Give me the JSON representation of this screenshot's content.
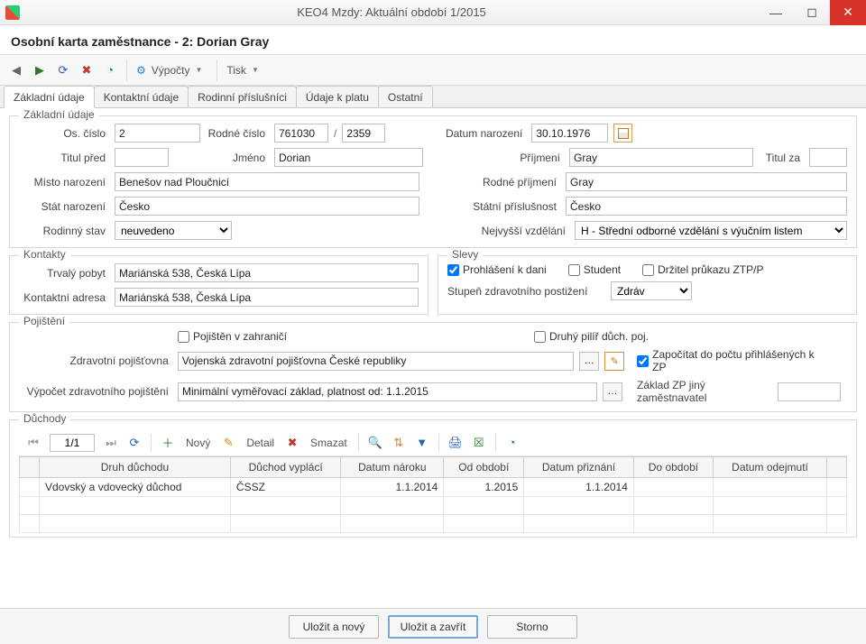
{
  "window": {
    "title": "KEO4 Mzdy: Aktuální období 1/2015"
  },
  "subtitle": "Osobní karta zaměstnance - 2: Dorian Gray",
  "toolbar": {
    "vypocty": "Výpočty",
    "tisk": "Tisk"
  },
  "tabs": [
    "Základní údaje",
    "Kontaktní údaje",
    "Rodinní příslušníci",
    "Údaje k platu",
    "Ostatní"
  ],
  "basic": {
    "legend": "Základní údaje",
    "lbl_oscislo": "Os. číslo",
    "oscislo": "2",
    "lbl_rodnecislo": "Rodné číslo",
    "rc1": "761030",
    "rc_sep": "/",
    "rc2": "2359",
    "lbl_datnar": "Datum narození",
    "datnar": "30.10.1976",
    "lbl_titulpred": "Titul před",
    "titulpred": "",
    "lbl_jmeno": "Jméno",
    "jmeno": "Dorian",
    "lbl_prijmeni": "Příjmení",
    "prijmeni": "Gray",
    "lbl_titulza": "Titul za",
    "titulza": "",
    "lbl_mistonar": "Místo narození",
    "mistonar": "Benešov nad Ploučnicí",
    "lbl_rodneprij": "Rodné příjmení",
    "rodneprij": "Gray",
    "lbl_statnar": "Stát narození",
    "statnar": "Česko",
    "lbl_statnipris": "Státní příslušnost",
    "statnipris": "Česko",
    "lbl_rodstav": "Rodinný stav",
    "rodstav": "neuvedeno",
    "lbl_vzdelani": "Nejvyšší vzdělání",
    "vzdelani": "H - Střední odborné vzdělání s výučním listem"
  },
  "kontakty": {
    "legend": "Kontakty",
    "lbl_trvaly": "Trvalý pobyt",
    "trvaly": "Mariánská 538, Česká Lípa",
    "lbl_kontakt": "Kontaktní adresa",
    "kontakt": "Mariánská 538, Česká Lípa"
  },
  "slevy": {
    "legend": "Slevy",
    "prohlaseni": "Prohlášení k dani",
    "student": "Student",
    "ztp": "Držitel průkazu ZTP/P",
    "lbl_stupen": "Stupeň zdravotního postižení",
    "stupen": "Zdráv"
  },
  "pojisteni": {
    "legend": "Pojištění",
    "zahranici": "Pojištěn v zahraničí",
    "druhypilir": "Druhý pilíř důch. poj.",
    "lbl_zp": "Zdravotní pojišťovna",
    "zp": "Vojenská zdravotní pojišťovna České republiky",
    "zapocitat": "Započítat do počtu přihlášených k ZP",
    "lbl_vypocet": "Výpočet zdravotního pojištění",
    "vypocet": "Minimální vyměřovací základ, platnost od: 1.1.2015",
    "lbl_zaklad": "Základ ZP jiný zaměstnavatel",
    "zaklad": ""
  },
  "duchody": {
    "legend": "Důchody",
    "pager": "1/1",
    "btn_novy": "Nový",
    "btn_detail": "Detail",
    "btn_smazat": "Smazat",
    "cols": [
      "Druh důchodu",
      "Důchod vyplácí",
      "Datum nároku",
      "Od období",
      "Datum přiznání",
      "Do období",
      "Datum odejmutí"
    ],
    "rows": [
      {
        "druh": "Vdovský a vdovecký důchod",
        "vyplaci": "ČSSZ",
        "naroku": "1.1.2014",
        "od": "1.2015",
        "priznani": "1.1.2014",
        "do": "",
        "odejmuti": ""
      }
    ]
  },
  "footer": {
    "save_new": "Uložit a nový",
    "save_close": "Uložit a zavřít",
    "cancel": "Storno"
  }
}
